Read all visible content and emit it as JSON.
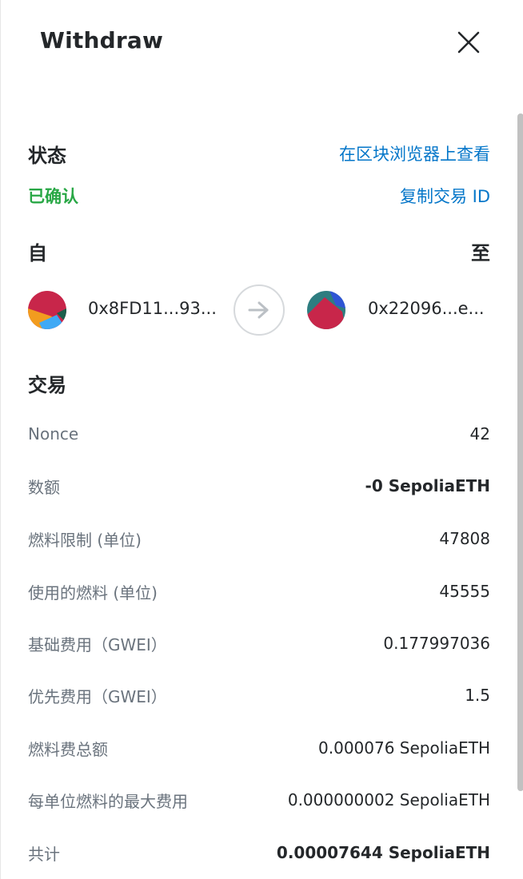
{
  "header": {
    "title": "Withdraw"
  },
  "status": {
    "label": "状态",
    "explorer_link": "在区块浏览器上查看",
    "value": "已确认",
    "copy_link": "复制交易 ID"
  },
  "parties": {
    "from_label": "自",
    "to_label": "至",
    "from_address": "0x8FD11...93...",
    "to_address": "0x22096...e..."
  },
  "transaction": {
    "heading": "交易",
    "rows": [
      {
        "label": "Nonce",
        "value": "42"
      },
      {
        "label": "数额",
        "value": "-0 SepoliaETH"
      },
      {
        "label": "燃料限制 (单位)",
        "value": "47808"
      },
      {
        "label": "使用的燃料 (单位)",
        "value": "45555"
      },
      {
        "label": "基础费用（GWEI）",
        "value": "0.177997036"
      },
      {
        "label": "优先费用（GWEI）",
        "value": "1.5"
      },
      {
        "label": "燃料费总额",
        "value": "0.000076 SepoliaETH"
      },
      {
        "label": "每单位燃料的最大费用",
        "value": "0.000000002 SepoliaETH"
      },
      {
        "label": "共计",
        "value": "0.00007644 SepoliaETH"
      }
    ]
  },
  "colors": {
    "link": "#0376c9",
    "success": "#28a745",
    "text": "#24272a",
    "muted": "#6a737d"
  },
  "icons": {
    "close": "close-icon",
    "arrow": "arrow-right-icon",
    "from_avatar": "jazzicon-avatar",
    "to_avatar": "jazzicon-avatar"
  }
}
